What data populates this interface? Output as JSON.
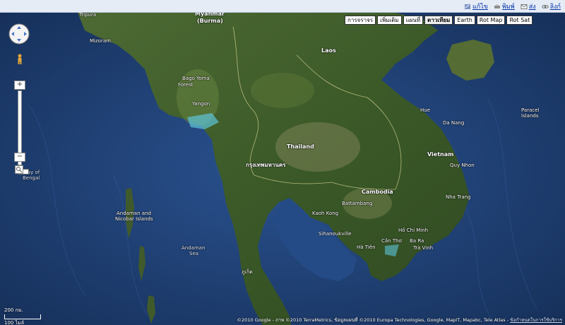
{
  "toplinks": {
    "edit": "แก้ไข",
    "print": "พิมพ์",
    "send": "ส่ง",
    "link": "ลิงก์"
  },
  "maptypes": [
    "การจราจร",
    "เพิ่มเติม",
    "แผนที่",
    "ดาวเทียม",
    "Earth",
    "Rot Map",
    "Rot Sat"
  ],
  "active_maptype": "ดาวเทียม",
  "zoom": {
    "plus": "+",
    "minus": "−"
  },
  "labels": {
    "tripura": "Tripura",
    "mizoram": "Mizoram",
    "myanmar": "Myanmar",
    "burma": "(Burma)",
    "laos": "Laos",
    "thailand": "Thailand",
    "cambodia": "Cambodia",
    "vietnam": "Vietnam",
    "hue": "Hue",
    "danang": "Da Nang",
    "quynhon": "Quy Nhon",
    "nhatrang": "Nha Trang",
    "kaohkong": "Kaoh Kong",
    "sihanoukville": "Sihanoukville",
    "hatien": "Hà Tiên",
    "cantho": "Cần Thơ",
    "bara": "Ba Ra",
    "travinh": "Trà Vinh",
    "battambang": "Battambang",
    "yangon": "Yangon",
    "bago": "Bago Yoma",
    "forest": "Forest",
    "bayofbengal1": "Bay of",
    "bayofbengal2": "Bengal",
    "andaman1": "Andaman and",
    "andaman2": "Nicobar Islands",
    "andamansea1": "Andaman",
    "andamansea2": "Sea",
    "paracel1": "Paracel",
    "paracel2": "Islands",
    "bangkok": "กรุงเทพมหานคร",
    "hochiminh": "Hồ Chí Minh",
    "phuket": "ภูเก็ต"
  },
  "scale": {
    "km": "200 กม.",
    "mi": "100 ไมล์"
  },
  "copyright": {
    "text": "©2010 Google - ภาพ ©2010 TerraMetrics, ข้อมูลแผนที่ ©2010 Europa Technologies, Google, MapIT, Mapabc, Tele Atlas - ",
    "link": "ข้อกำหนดในการใช้บริการ"
  },
  "colors": {
    "ocean": "#1d3f74",
    "land": "#3e5a2a",
    "link": "#0033aa"
  }
}
